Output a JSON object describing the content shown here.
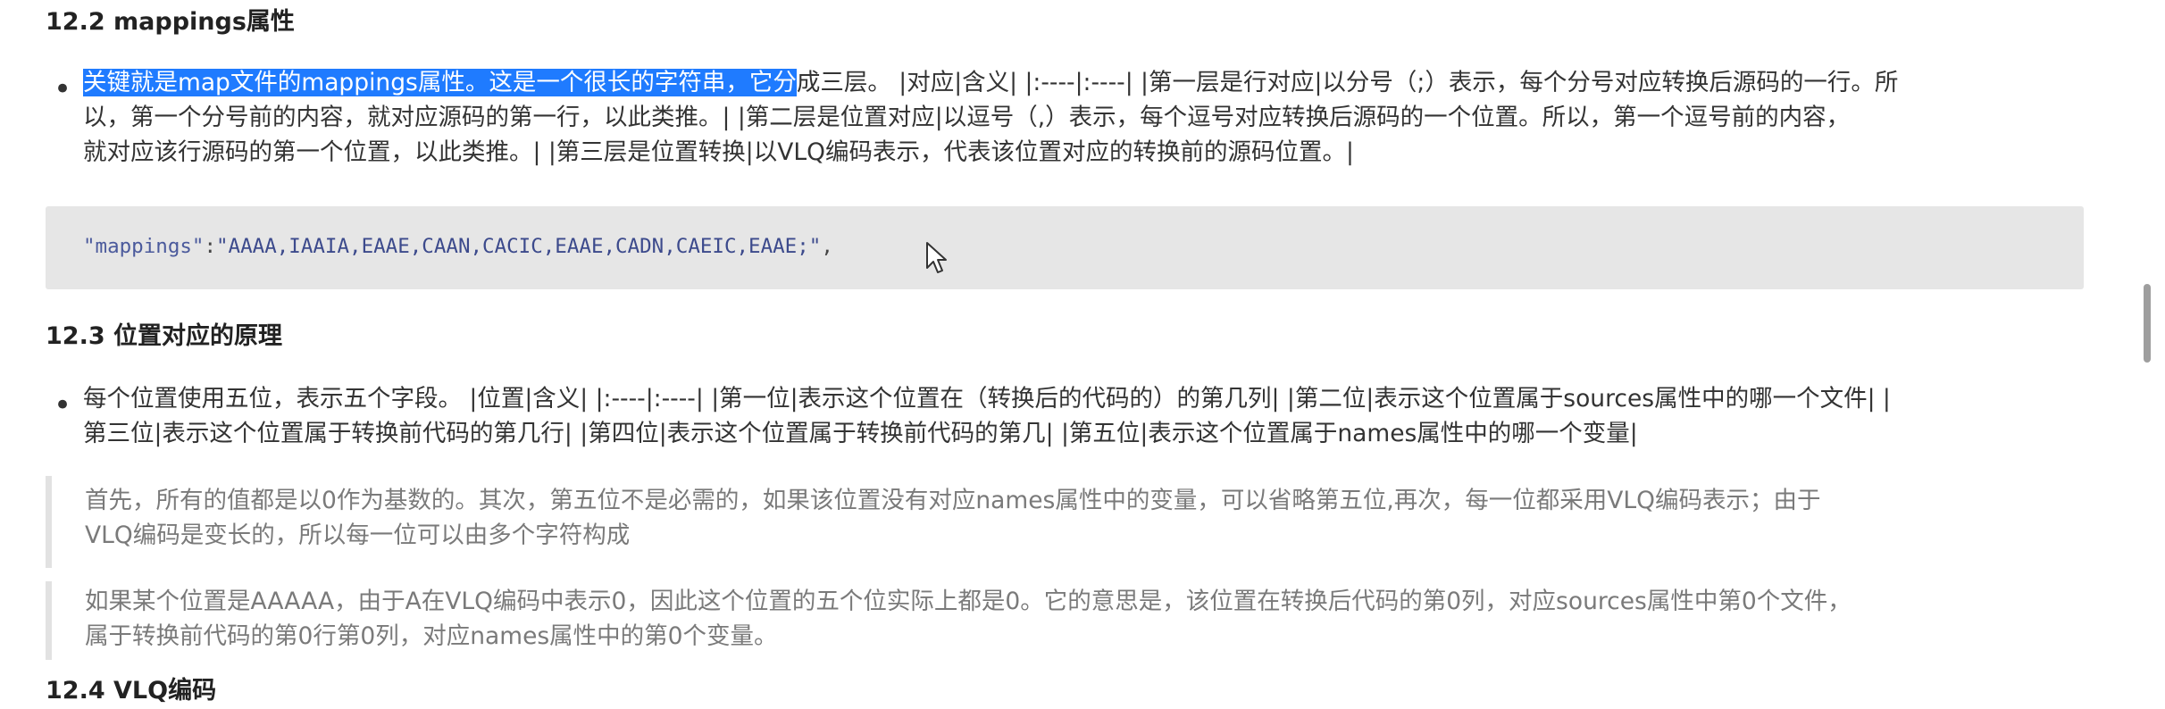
{
  "sections": {
    "s122": {
      "heading": "12.2 mappings属性",
      "bullet": {
        "highlighted": "关键就是map文件的mappings属性。这是一个很长的字符串，它分",
        "line1_rest": "成三层。 |对应|含义| |:----|:----| |第一层是行对应|以分号（;）表示，每个分号对应转换后源码的一行。所",
        "line2": "以，第一个分号前的内容，就对应源码的第一行，以此类推。| |第二层是位置对应|以逗号（,）表示，每个逗号对应转换后源码的一个位置。所以，第一个逗号前的内容，",
        "line3": "就对应该行源码的第一个位置，以此类推。| |第三层是位置转换|以VLQ编码表示，代表该位置对应的转换前的源码位置。|"
      },
      "code": {
        "key": "\"mappings\"",
        "colon": ":",
        "value": "\"AAAA,IAAIA,EAAE,CAAN,CACIC,EAAE,CADN,CAEIC,EAAE;\"",
        "trailing": ","
      }
    },
    "s123": {
      "heading": "12.3 位置对应的原理",
      "bullet": {
        "line1": "每个位置使用五位，表示五个字段。 |位置|含义| |:----|:----| |第一位|表示这个位置在（转换后的代码的）的第几列| |第二位|表示这个位置属于sources属性中的哪一个文件| |",
        "line2": "第三位|表示这个位置属于转换前代码的第几行| |第四位|表示这个位置属于转换前代码的第几| |第五位|表示这个位置属于names属性中的哪一个变量|"
      },
      "quote1": {
        "line1": "首先，所有的值都是以0作为基数的。其次，第五位不是必需的，如果该位置没有对应names属性中的变量，可以省略第五位,再次，每一位都采用VLQ编码表示；由于",
        "line2": "VLQ编码是变长的，所以每一位可以由多个字符构成"
      },
      "quote2": {
        "line1": "如果某个位置是AAAAA，由于A在VLQ编码中表示0，因此这个位置的五个位实际上都是0。它的意思是，该位置在转换后代码的第0列，对应sources属性中第0个文件，",
        "line2": "属于转换前代码的第0行第0列，对应names属性中的第0个变量。"
      }
    },
    "s124": {
      "heading": "12.4 VLQ编码"
    }
  },
  "colors": {
    "selection_highlight": "#1f7bff",
    "code_background": "#e6e6e6",
    "quote_border": "#e2e2e2",
    "quote_text": "#7a7a7a"
  },
  "icons": {
    "cursor": "mouse-pointer-icon"
  }
}
